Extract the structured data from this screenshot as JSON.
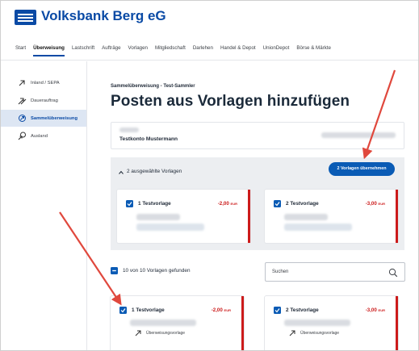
{
  "brand": {
    "name": "Volksbank Berg eG"
  },
  "nav": {
    "items": [
      {
        "label": "Start"
      },
      {
        "label": "Überweisung"
      },
      {
        "label": "Lastschrift"
      },
      {
        "label": "Aufträge"
      },
      {
        "label": "Vorlagen"
      },
      {
        "label": "Mitgliedschaft"
      },
      {
        "label": "Darlehen"
      },
      {
        "label": "Handel & Depot"
      },
      {
        "label": "UnionDepot"
      },
      {
        "label": "Börse & Märkte"
      }
    ],
    "active_index": 1
  },
  "sidebar": {
    "items": [
      {
        "label": "Inland / SEPA",
        "icon": "arrow-up-right-icon"
      },
      {
        "label": "Dauerauftrag",
        "icon": "repeat-arrow-icon"
      },
      {
        "label": "Sammelüberweisung",
        "icon": "collective-transfer-icon"
      },
      {
        "label": "Ausland",
        "icon": "globe-transfer-icon"
      }
    ],
    "active_index": 2
  },
  "main": {
    "breadcrumb": "Sammelüberweisung - Test-Sammler",
    "title": "Posten aus Vorlagen hinzufügen",
    "account_name": "Testkonto Mustermann",
    "selected": {
      "label": "2 ausgewählte Vorlagen",
      "button": "2 Vorlagen übernehmen",
      "cards": [
        {
          "name": "1 Testvorlage",
          "amount": "-2,00",
          "currency": "EUR"
        },
        {
          "name": "2 Testvorlage",
          "amount": "-3,00",
          "currency": "EUR"
        }
      ]
    },
    "found_label": "10 von 10 Vorlagen gefunden",
    "search_placeholder": "Suchen",
    "list_cards": [
      {
        "name": "1 Testvorlage",
        "amount": "-2,00",
        "currency": "EUR",
        "type": "Überweisungsvorlage"
      },
      {
        "name": "2 Testvorlage",
        "amount": "-3,00",
        "currency": "EUR",
        "type": "Überweisungsvorlage"
      }
    ]
  },
  "colors": {
    "brand_blue": "#0a4aa5",
    "button_blue": "#0a5bb5",
    "amount_red": "#cc1b1b",
    "annotation_red": "#e0483d"
  }
}
